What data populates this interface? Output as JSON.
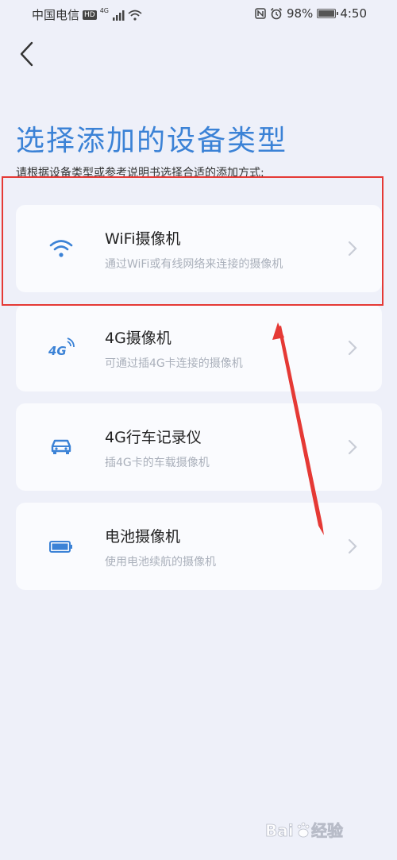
{
  "status_bar": {
    "carrier": "中国电信",
    "hd": "HD",
    "network": "4G",
    "battery": "98%",
    "time": "4:50"
  },
  "header": {
    "title": "选择添加的设备类型",
    "subtitle": "请根据设备类型或参考说明书选择合适的添加方式:"
  },
  "devices": [
    {
      "title": "WiFi摄像机",
      "desc": "通过WiFi或有线网络来连接的摄像机",
      "icon": "wifi-icon"
    },
    {
      "title": "4G摄像机",
      "desc": "可通过插4G卡连接的摄像机",
      "icon": "4g-icon"
    },
    {
      "title": "4G行车记录仪",
      "desc": "插4G卡的车载摄像机",
      "icon": "car-icon"
    },
    {
      "title": "电池摄像机",
      "desc": "使用电池续航的摄像机",
      "icon": "battery-icon"
    }
  ],
  "colors": {
    "accent": "#3b82d6",
    "background": "#eef0f9",
    "card": "#fafbfe",
    "annotation": "#e53935"
  },
  "watermark": "Baidu经验"
}
